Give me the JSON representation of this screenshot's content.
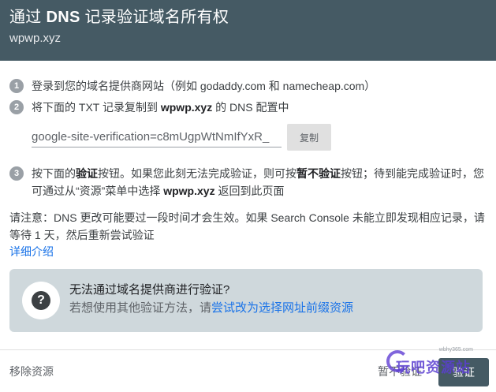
{
  "header": {
    "title_prefix": "通过 ",
    "title_bold": "DNS",
    "title_suffix": " 记录验证域名所有权",
    "domain": "wpwp.xyz"
  },
  "steps": {
    "step1": {
      "number": "1",
      "text": "登录到您的域名提供商网站（例如 godaddy.com 和 namecheap.com）"
    },
    "step2": {
      "number": "2",
      "text_before": "将下面的 TXT 记录复制到 ",
      "domain": "wpwp.xyz",
      "text_after": " 的 DNS 配置中",
      "txt_record": "google-site-verification=c8mUgpWtNmIfYxR_",
      "copy_label": "复制"
    },
    "step3": {
      "number": "3",
      "part1": "按下面的",
      "bold1": "验证",
      "part2": "按钮。如果您此刻无法完成验证，则可按",
      "bold2": "暂不验证",
      "part3": "按钮；待到能完成验证时，您可通过从“资源”菜单中选择 ",
      "bold3": "wpwp.xyz",
      "part4": " 返回到此页面"
    }
  },
  "note": {
    "text": "请注意：DNS 更改可能要过一段时间才会生效。如果 Search Console 未能立即发现相应记录，请等待 1 天，然后重新尝试验证",
    "learn_more": "详细介绍"
  },
  "alt_box": {
    "icon": "help-icon",
    "title": "无法通过域名提供商进行验证?",
    "desc_prefix": "若想使用其他验证方法，请",
    "link": "尝试改为选择网址前缀资源"
  },
  "footer": {
    "remove_label": "移除资源",
    "skip_label": "暂不验证",
    "verify_label": "验证"
  },
  "watermark": {
    "small": "wbhy365.com",
    "text": "玩吧资源站"
  },
  "colors": {
    "header_bg": "#455a64",
    "link": "#1a73e8",
    "alt_box_bg": "#cfd8dc",
    "verify_bg": "#455a64"
  }
}
